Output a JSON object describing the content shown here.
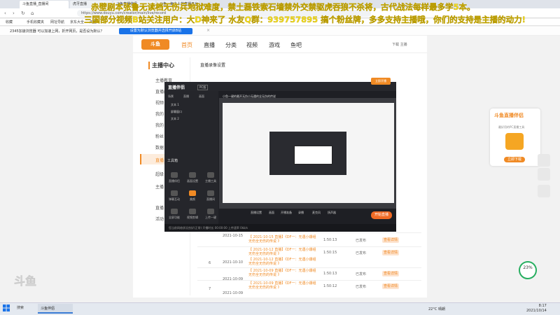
{
  "browser": {
    "tabs": [
      "斗鱼直播_直播间",
      "虎牙直播",
      "斗鱼直播伴侣",
      "斗鱼 - 每个人的直播平台"
    ],
    "url": "https://www.douyu.com/creator/main/live/record",
    "bookmarks": [
      "收藏",
      "手机收藏夹",
      "网址导航",
      "京东大全",
      "淘宝"
    ],
    "notification": {
      "text": "2345加速浏览器 可以加速上网，折开网页，是否设为默认？",
      "button": "设置为默认浏览器并选择开启B站",
      "close": "×"
    }
  },
  "site": {
    "logo": "斗鱼",
    "nav": [
      "首页",
      "直播",
      "分类",
      "视频",
      "游戏",
      "鱼吧"
    ],
    "user": "下载  主播",
    "sidebar": {
      "heading": "主播中心",
      "items": [
        "主播教育",
        "直播间",
        "视频",
        "我的",
        "我的",
        "粉丝",
        "数据",
        "直播",
        "超级",
        "主播",
        "直播",
        "活动"
      ]
    },
    "page_heading": "直播录像设置",
    "rows": [
      {
        "no": "",
        "date": "2021-10-15",
        "titles": [
          "【 2021-10-15 直播】《DF一：无遇小爆组无伤全无伤的传说 》",
          "【 2021-10-15 直播】《DF一：无遇小爆组无伤全无伤的传说 》"
        ],
        "duration": "1:50:13",
        "status": "已发布",
        "action": "查看详情"
      },
      {
        "no": "6",
        "date": "2021-10-10",
        "titles": [
          "【 2021-10-12 直播】《DF一：无遇小爆组无伤全无伤的传说 》",
          "【 2021-10-12 直播】《DF一：无遇小爆组无伤全无伤的传说 》"
        ],
        "duration": "1:50:15",
        "status": "已发布",
        "action": "查看详情"
      },
      {
        "no": "",
        "date": "2021-10-09",
        "titles": [
          "【 2021-10-09 直播】《DF一：无遇小爆组无伤全无伤的传说 》"
        ],
        "duration": "1:50:13",
        "status": "已发布",
        "action": "查看详情"
      },
      {
        "no": "7",
        "date": "2021-10-09",
        "titles": [
          "【 2021-10-09 直播】《DF一：无遇小爆组无伤全无伤的传说 》"
        ],
        "duration": "1:50:12",
        "status": "已发布",
        "action": "查看详情"
      }
    ],
    "banner": {
      "title": "斗鱼直播伴侣",
      "sub": "最好用的PC直播工具",
      "button": "立即下载"
    },
    "progress": "23%"
  },
  "app": {
    "logo": "直播伴侣",
    "badge": "PC版",
    "window_title": "小鱼一键的最开无伤小无遇的全无伤的传说",
    "scene_tabs": [
      "场景",
      "直播",
      "画面"
    ],
    "layers": [
      "文本 1",
      "屏幕窗口",
      "文本 2"
    ],
    "tools_label": "工具箱",
    "tools": [
      {
        "label": "直播伴侣"
      },
      {
        "label": "画面设置"
      },
      {
        "label": "主播工具"
      },
      {
        "label": "弹幕互动"
      },
      {
        "label": "美颜"
      },
      {
        "label": "直播间"
      },
      {
        "label": "全屏功能"
      },
      {
        "label": "视频剪辑"
      },
      {
        "label": "上传一键"
      }
    ],
    "bottom": [
      "直播设置",
      "画面",
      "开播准备",
      "录播",
      "麦克风",
      "扬声器"
    ],
    "start_button": "开始直播",
    "top_right_button": "立即开播",
    "status": "您当前网络状况良好(正常)   开播时长 00:00:00   上传速率 0kb/s"
  },
  "overlay_text": [
    "赤壁剧本张鲁无读档无伤兵地狱难度，禁土磊铁索石墙禁外交禁驱虎吞狼不杀将，古代战法每样最多学5本。",
    "三国部分视频B站关注用户：大D神来了   水友Q群：939757895   搞个粉丝牌，多多支持主播哦，你们的支持是主播的动力!"
  ],
  "taskbar": {
    "search": "搜索",
    "app": "斗鱼伴侣",
    "weather": "22°C 晴朗",
    "time": "8:17",
    "date": "2021/10/14"
  },
  "watermark": "斗鱼"
}
